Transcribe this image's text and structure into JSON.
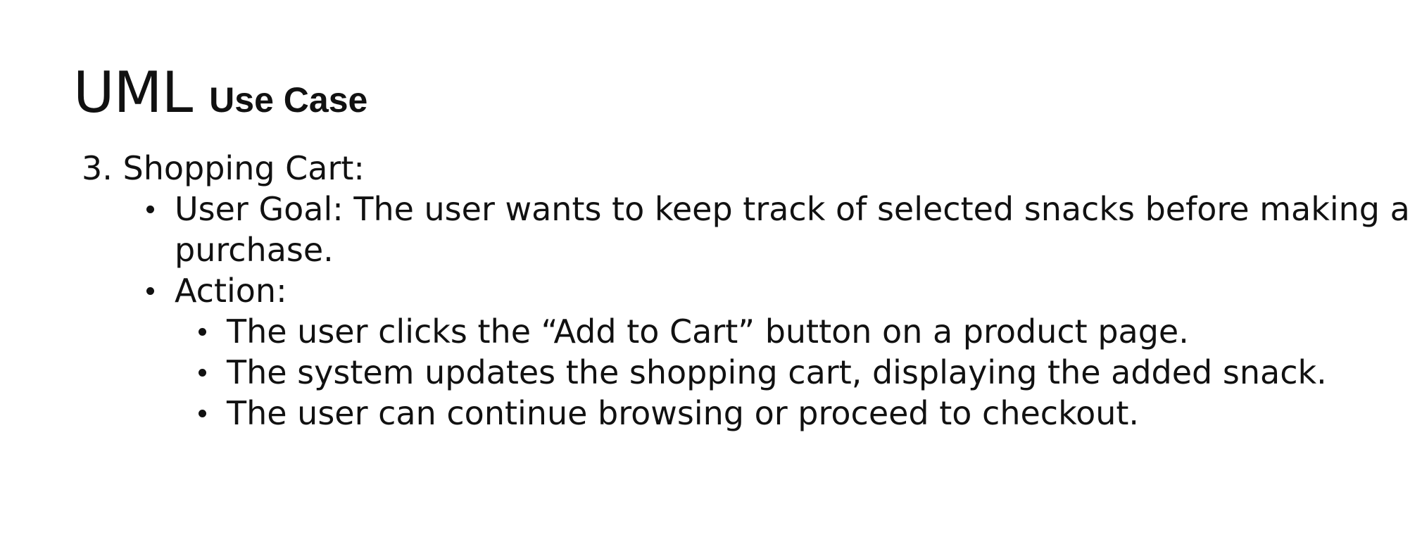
{
  "title": {
    "main": "UML",
    "sub": "Use Case"
  },
  "section": {
    "number": "3.",
    "heading": "Shopping Cart:",
    "items": [
      {
        "text": "User Goal: The user wants to keep track of selected snacks before making a purchase."
      },
      {
        "text": "Action:",
        "subitems": [
          "The user clicks the “Add to Cart” button on a product page.",
          "The system updates the shopping cart, displaying the added snack.",
          "The user can continue browsing or proceed to checkout."
        ]
      }
    ]
  }
}
